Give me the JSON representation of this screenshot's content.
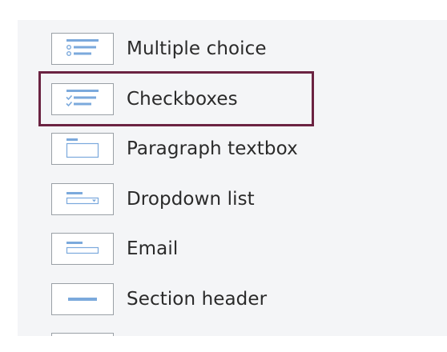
{
  "question_types": [
    {
      "label": "Multiple choice",
      "icon": "multiple-choice-icon",
      "selected": false
    },
    {
      "label": "Checkboxes",
      "icon": "checkboxes-icon",
      "selected": true
    },
    {
      "label": "Paragraph textbox",
      "icon": "paragraph-textbox-icon",
      "selected": false
    },
    {
      "label": "Dropdown list",
      "icon": "dropdown-list-icon",
      "selected": false
    },
    {
      "label": "Email",
      "icon": "email-icon",
      "selected": false
    },
    {
      "label": "Section header",
      "icon": "section-header-icon",
      "selected": false
    }
  ],
  "colors": {
    "icon_blue": "#7ba9dc",
    "selection_outline": "#6b2342",
    "panel_background": "#f4f5f7",
    "label_text": "#2a2a2a"
  }
}
